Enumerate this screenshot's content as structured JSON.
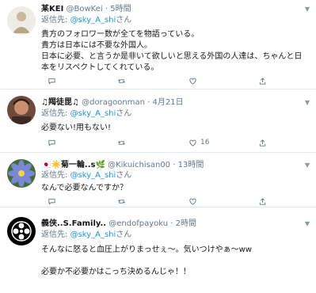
{
  "colors": {
    "accent": "#1b95e0",
    "muted": "#657786",
    "text": "#14171a",
    "divider": "#e1e8ed"
  },
  "tweets": [
    {
      "name": "某KEI",
      "handle": "@BowKei",
      "dot": "·",
      "time": "5時間",
      "reply_prefix": "返信先:",
      "reply_to": "@sky_A_shi",
      "reply_suffix": "さん",
      "text": "貴方のフォロワー数が全てを物語っている。\n貴方は日本には不要な外国人。\n日本に必要、と言うか是非いて欲しいと思える外国の人達は、ちゃんと日本をリスペクトしてくれている。",
      "reply_count": "",
      "retweet_count": "",
      "like_count": ""
    },
    {
      "name": "♫羯徒毘♫",
      "handle": "@doragoonman",
      "dot": "·",
      "time": "4月21日",
      "reply_prefix": "返信先:",
      "reply_to": "@sky_A_shi",
      "reply_suffix": "さん",
      "text": "必要ない!用もない!",
      "reply_count": "",
      "retweet_count": "",
      "like_count": "16"
    },
    {
      "name": "🇯🇵☀️菊一輪..s🌿",
      "handle": "@Kikuichisan00",
      "dot": "·",
      "time": "13時間",
      "reply_prefix": "返信先:",
      "reply_to": "@sky_A_shi",
      "reply_suffix": "さん",
      "text": "なんで必要なんですか？",
      "reply_count": "",
      "retweet_count": "",
      "like_count": ""
    },
    {
      "name": "義侠..S.Family..",
      "handle": "@endofpayoku",
      "dot": "·",
      "time": "2時間",
      "reply_prefix": "返信先:",
      "reply_to": "@sky_A_shi",
      "reply_suffix": "さん",
      "text": "そんなに怒ると血圧上がりまっせぇ～。気いつけやぁ～ww\n\n必要か不必要かはこっち決めるんじゃ！！",
      "reply_count": "",
      "retweet_count": "",
      "like_count": ""
    }
  ]
}
